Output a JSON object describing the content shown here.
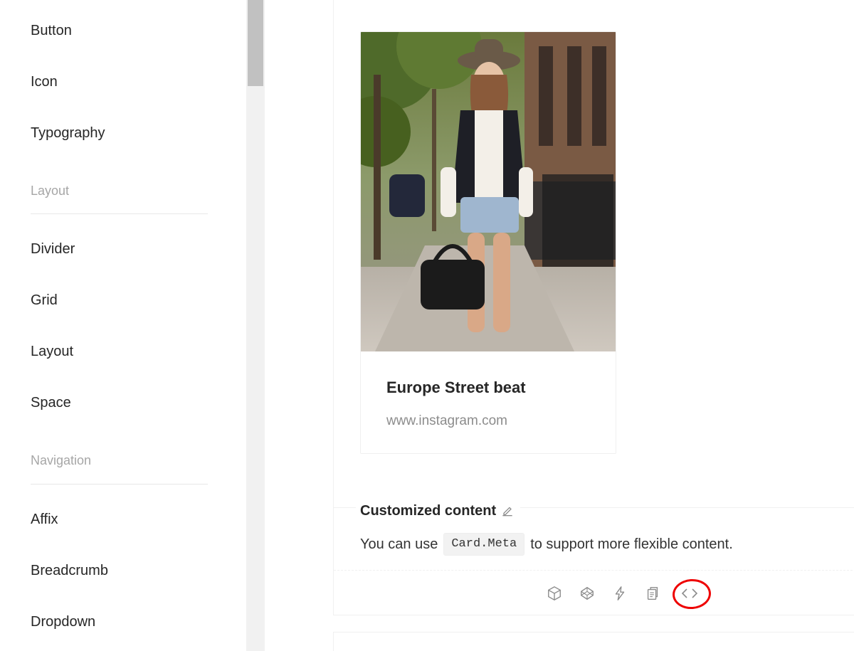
{
  "sidebar": {
    "items": [
      {
        "label": "Button"
      },
      {
        "label": "Icon"
      },
      {
        "label": "Typography"
      },
      {
        "label": "Divider"
      },
      {
        "label": "Grid"
      },
      {
        "label": "Layout"
      },
      {
        "label": "Space"
      },
      {
        "label": "Affix"
      },
      {
        "label": "Breadcrumb"
      },
      {
        "label": "Dropdown"
      }
    ],
    "groups": [
      {
        "title": "Layout"
      },
      {
        "title": "Navigation"
      }
    ]
  },
  "card": {
    "title": "Europe Street beat",
    "description": "www.instagram.com",
    "cover_alt": "Street fashion photo"
  },
  "meta_section": {
    "title": "Customized content",
    "desc_before": "You can use",
    "code": "Card.Meta",
    "desc_after": "to support more flexible content."
  },
  "actions": {
    "icons": [
      "codesandbox-icon",
      "codepen-icon",
      "stackblitz-icon",
      "copy-icon",
      "code-expand-icon"
    ],
    "highlighted": "code-expand-icon",
    "highlight_color": "#e00000"
  }
}
